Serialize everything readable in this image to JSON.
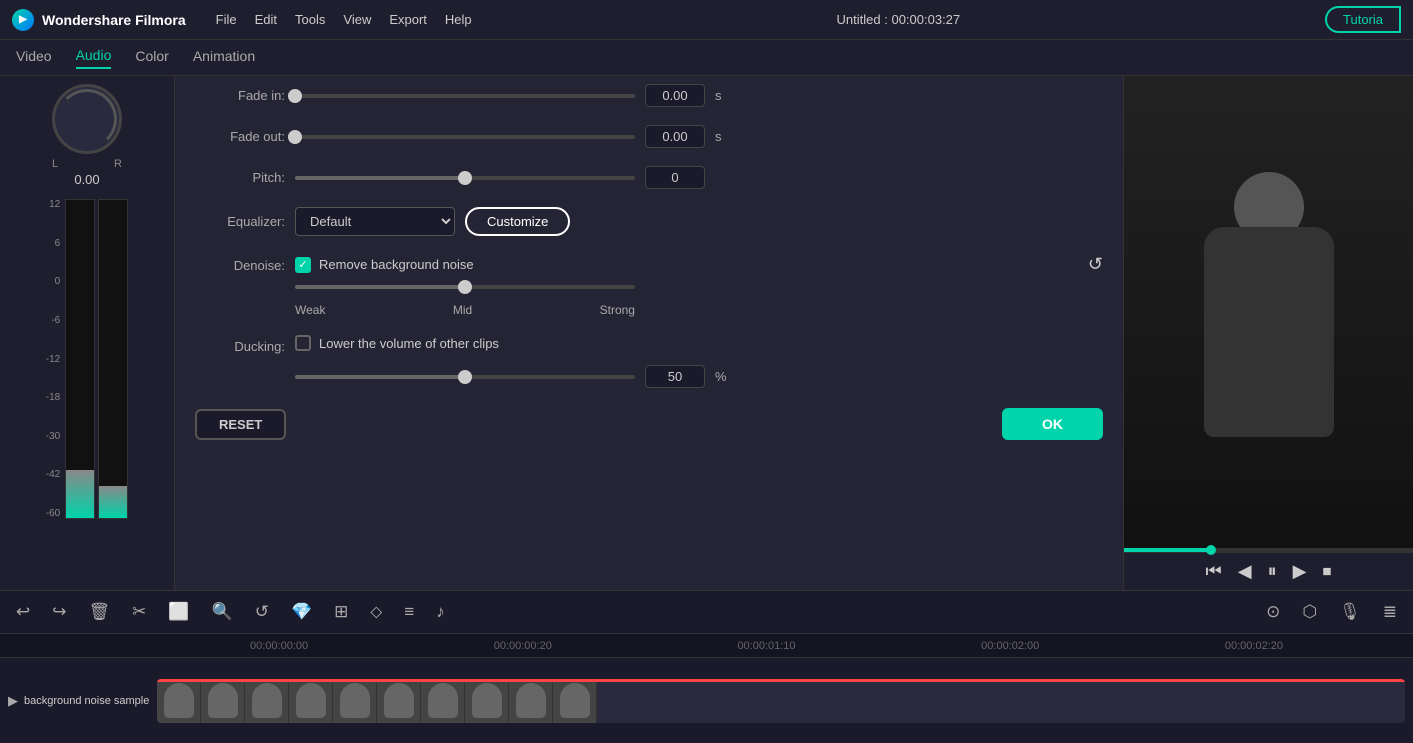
{
  "app": {
    "name": "Wondershare Filmora",
    "title": "Untitled : 00:00:03:27",
    "tutorial_label": "Tutoria"
  },
  "menu": {
    "items": [
      "File",
      "Edit",
      "Tools",
      "View",
      "Export",
      "Help"
    ]
  },
  "tabs": {
    "items": [
      "Video",
      "Audio",
      "Color",
      "Animation"
    ],
    "active": "Audio"
  },
  "audio_panel": {
    "fade_in_label": "Fade in:",
    "fade_in_value": "0.00",
    "fade_in_unit": "s",
    "fade_out_label": "Fade out:",
    "fade_out_value": "0.00",
    "fade_out_unit": "s",
    "pitch_label": "Pitch:",
    "pitch_value": "0",
    "equalizer_label": "Equalizer:",
    "equalizer_value": "Default",
    "customize_label": "Customize",
    "denoise_label": "Denoise:",
    "denoise_checkbox_label": "Remove background noise",
    "denoise_weak": "Weak",
    "denoise_mid": "Mid",
    "denoise_strong": "Strong",
    "ducking_label": "Ducking:",
    "ducking_checkbox_label": "Lower the volume of other clips",
    "ducking_value": "50",
    "ducking_unit": "%"
  },
  "left_panel": {
    "lr_left": "L",
    "lr_right": "R",
    "knob_value": "0.00",
    "scale_values": [
      "12",
      "6",
      "0",
      "-6",
      "-12",
      "-18",
      "-30",
      "-42",
      "-60"
    ]
  },
  "buttons": {
    "reset": "RESET",
    "ok": "OK"
  },
  "video_controls": {
    "rewind": "⏮",
    "play_back": "◀",
    "pause": "⏸",
    "play": "▶",
    "stop": "⏹"
  },
  "toolbar": {
    "icons": [
      "↩",
      "↪",
      "🗑",
      "✂",
      "⬜",
      "🔍",
      "↺",
      "💎",
      "⊞",
      "⬦",
      "≡",
      "♪"
    ]
  },
  "timeline": {
    "ruler_marks": [
      "00:00:00:00",
      "00:00:00:20",
      "00:00:01:10",
      "00:00:02:00",
      "00:00:02:20"
    ],
    "track_label": "background noise sample"
  },
  "slider_positions": {
    "fade_out_pct": 0,
    "pitch_pct": 50,
    "denoise_pct": 50,
    "ducking_pct": 50
  }
}
